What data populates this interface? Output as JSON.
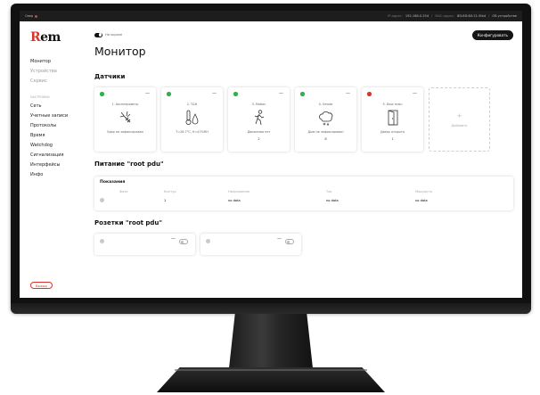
{
  "topbar": {
    "left_label": "Cвер",
    "ip_label": "IP-адрес:",
    "ip_value": "192.168.0.254",
    "mac_label": "MAC-адрес:",
    "mac_value": "8D:8D:80:21:3fa4",
    "device_label": "Об устройстве"
  },
  "sidebar": {
    "logo_r": "R",
    "logo_rest": "em",
    "items_top": [
      "Монитор",
      "Устройства",
      "Сервис"
    ],
    "section_label": "НАСТРОЙКИ",
    "items_settings": [
      "Сеть",
      "Учетные записи",
      "Протоколы",
      "Время",
      "Watchdog",
      "Сигнализация",
      "Интерфейсы",
      "Инфо"
    ],
    "logout_label": "Выход"
  },
  "main": {
    "toggle_label": "На экране",
    "config_button": "Конфигуровать",
    "title": "Монитор",
    "sensors_title": "Датчики",
    "power_title": "Питание \"root pdu\"",
    "sockets_title": "Розетки \"root pdu\""
  },
  "sensors": [
    {
      "name": "1. Акселерометр",
      "state": "Удар не зафиксирован",
      "value": "",
      "status_color": "#2bb24c",
      "icon": "shock-icon"
    },
    {
      "name": "2. T&H",
      "state": "",
      "value": "T=26.7°C, H=47%RH",
      "status_color": "#2bb24c",
      "icon": "thermometer-humidity-icon"
    },
    {
      "name": "3. Motion",
      "state": "Движения нет",
      "value": "2",
      "status_color": "#2bb24c",
      "icon": "walking-person-icon"
    },
    {
      "name": "4. Smoke",
      "state": "Дым не зафиксирован",
      "value": "8",
      "status_color": "#2bb24c",
      "icon": "smoke-icon"
    },
    {
      "name": "5. Door main",
      "state": "Дверь открыта",
      "value": "1",
      "status_color": "#d9352b",
      "icon": "door-icon"
    }
  ],
  "add_card": {
    "plus": "+",
    "label": "Добавить"
  },
  "power": {
    "panel_title": "Показания",
    "headers": [
      "",
      "Фаза",
      "Контур",
      "Напряжение",
      "Ток",
      "Мощность"
    ],
    "row": [
      "",
      "1",
      "no data",
      "no data",
      "no data"
    ]
  },
  "sockets": [
    {
      "dash": "—"
    },
    {
      "dash": "—"
    }
  ],
  "common": {
    "menu_dash": "—"
  }
}
